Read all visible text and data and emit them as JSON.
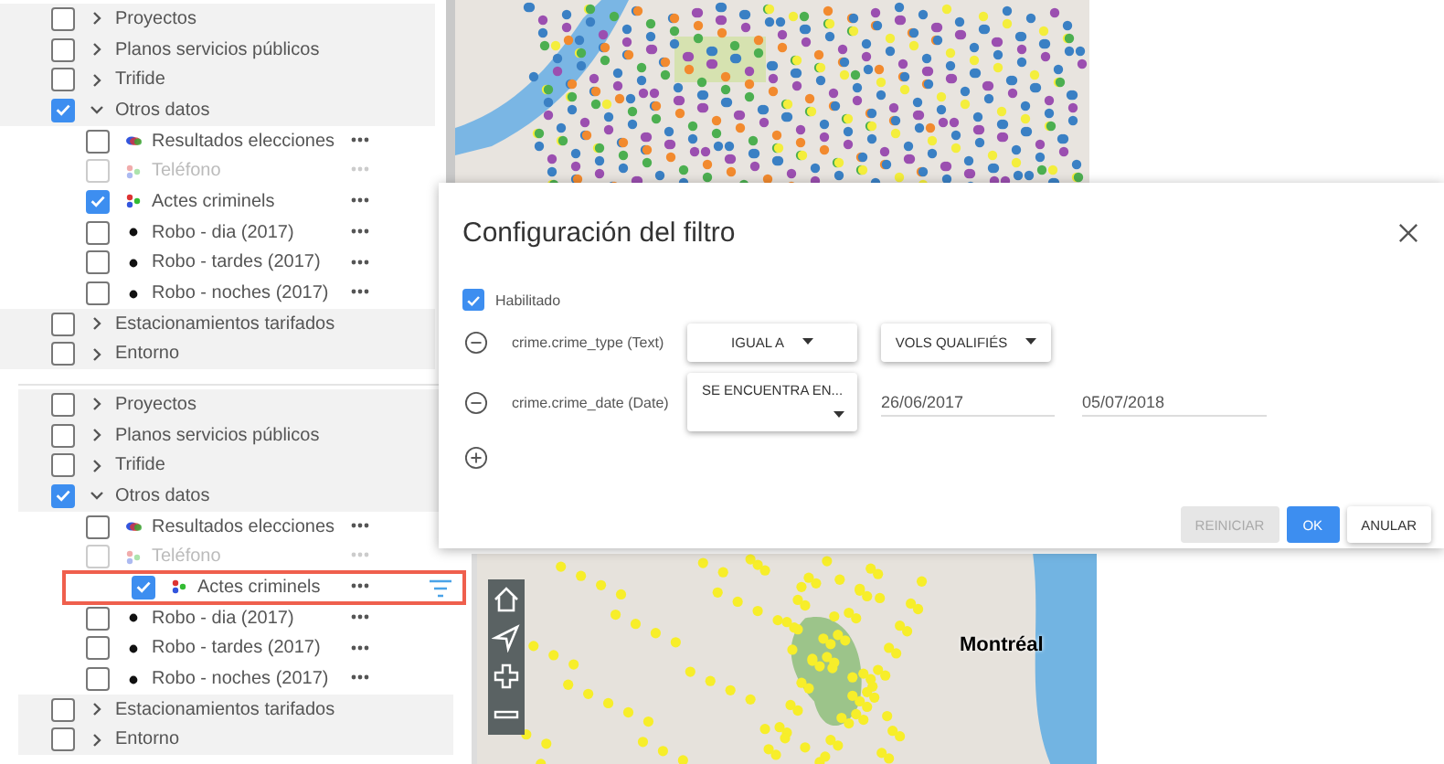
{
  "panels": [
    {
      "layers": [
        {
          "label": "Proyectos",
          "checked": false,
          "expanded": false
        },
        {
          "label": "Planos servicios públicos",
          "checked": false,
          "expanded": false
        },
        {
          "label": "Trifide",
          "checked": false,
          "expanded": false
        },
        {
          "label": "Otros datos",
          "checked": true,
          "expanded": true,
          "children": [
            {
              "label": "Resultados elecciones",
              "checked": false,
              "disabled": false,
              "kind": "blobs",
              "highlighted": false,
              "filtered": false
            },
            {
              "label": "Teléfono",
              "checked": false,
              "disabled": true,
              "kind": "dots",
              "highlighted": false,
              "filtered": false
            },
            {
              "label": "Actes criminels",
              "checked": true,
              "disabled": false,
              "kind": "dots",
              "highlighted": false,
              "filtered": false
            },
            {
              "label": "Robo - dia (2017)",
              "checked": false,
              "disabled": false,
              "kind": "point",
              "highlighted": false,
              "filtered": false
            },
            {
              "label": "Robo - tardes (2017)",
              "checked": false,
              "disabled": false,
              "kind": "point",
              "highlighted": false,
              "filtered": false
            },
            {
              "label": "Robo - noches (2017)",
              "checked": false,
              "disabled": false,
              "kind": "point",
              "highlighted": false,
              "filtered": false
            }
          ]
        },
        {
          "label": "Estacionamientos tarifados",
          "checked": false,
          "expanded": false
        },
        {
          "label": "Entorno",
          "checked": false,
          "expanded": false
        }
      ],
      "map": {
        "kind": "colored-points"
      }
    },
    {
      "layers": [
        {
          "label": "Proyectos",
          "checked": false,
          "expanded": false
        },
        {
          "label": "Planos servicios públicos",
          "checked": false,
          "expanded": false
        },
        {
          "label": "Trifide",
          "checked": false,
          "expanded": false
        },
        {
          "label": "Otros datos",
          "checked": true,
          "expanded": true,
          "children": [
            {
              "label": "Resultados elecciones",
              "checked": false,
              "disabled": false,
              "kind": "blobs",
              "highlighted": false,
              "filtered": false
            },
            {
              "label": "Teléfono",
              "checked": false,
              "disabled": true,
              "kind": "dots",
              "highlighted": false,
              "filtered": false
            },
            {
              "label": "Actes criminels",
              "checked": true,
              "disabled": false,
              "kind": "dots",
              "highlighted": true,
              "filtered": true
            },
            {
              "label": "Robo - dia (2017)",
              "checked": false,
              "disabled": false,
              "kind": "point",
              "highlighted": false,
              "filtered": false
            },
            {
              "label": "Robo - tardes (2017)",
              "checked": false,
              "disabled": false,
              "kind": "point",
              "highlighted": false,
              "filtered": false
            },
            {
              "label": "Robo - noches (2017)",
              "checked": false,
              "disabled": false,
              "kind": "point",
              "highlighted": false,
              "filtered": false
            }
          ]
        },
        {
          "label": "Estacionamientos tarifados",
          "checked": false,
          "expanded": false
        },
        {
          "label": "Entorno",
          "checked": false,
          "expanded": false
        }
      ],
      "map": {
        "kind": "yellow-points",
        "label": "Montréal",
        "controls": true
      }
    }
  ],
  "dialog": {
    "title": "Configuración del filtro",
    "enabled": {
      "label": "Habilitado",
      "checked": true
    },
    "conditions": [
      {
        "field": "crime.crime_type (Text)",
        "operator": "IGUAL A",
        "kind": "select",
        "value": "VOLS QUALIFIÉS"
      },
      {
        "field": "crime.crime_date (Date)",
        "operator": "SE ENCUENTRA EN...",
        "kind": "range",
        "from": "26/06/2017",
        "to": "05/07/2018"
      }
    ],
    "buttons": [
      {
        "label": "REINICIAR",
        "kind": "disabled"
      },
      {
        "label": "OK",
        "kind": "primary"
      },
      {
        "label": "ANULAR",
        "kind": "default"
      }
    ]
  }
}
